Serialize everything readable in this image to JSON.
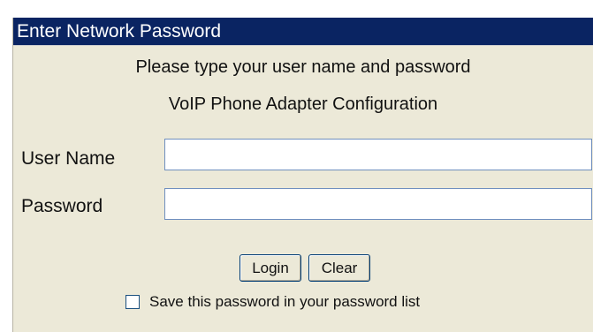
{
  "dialog": {
    "title": "Enter Network Password",
    "prompt": "Please type your user name and password",
    "subtitle": "VoIP Phone Adapter Configuration"
  },
  "form": {
    "username_label": "User Name",
    "username_value": "",
    "password_label": "Password",
    "password_value": ""
  },
  "buttons": {
    "login_label": "Login",
    "clear_label": "Clear"
  },
  "save_password": {
    "label": "Save this password in your password list",
    "checked": false
  },
  "colors": {
    "title_bar": "#0a2462",
    "dialog_background": "#ece9d8"
  }
}
